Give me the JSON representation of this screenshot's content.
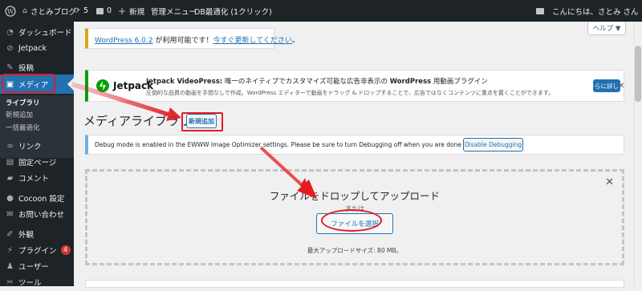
{
  "adminbar": {
    "site_name": "さとみブログ",
    "updates": "5",
    "comments": "0",
    "new_label": "新規",
    "admin_menu": "管理メニュー",
    "db_optimize": "DB最適化 (1クリック)",
    "greeting": "こんにちは、さとみ さん"
  },
  "sidebar": {
    "items": [
      {
        "label": "ダッシュボード",
        "icon": "dashboard-icon"
      },
      {
        "label": "Jetpack",
        "icon": "jetpack-icon"
      },
      {
        "label": "投稿",
        "icon": "pin-icon"
      },
      {
        "label": "メディア",
        "icon": "media-icon"
      },
      {
        "label": "リンク",
        "icon": "link-icon"
      },
      {
        "label": "固定ページ",
        "icon": "page-icon"
      },
      {
        "label": "コメント",
        "icon": "comment-icon"
      },
      {
        "label": "Cocoon 設定",
        "icon": "cocoon-icon"
      },
      {
        "label": "お問い合わせ",
        "icon": "mail-icon"
      },
      {
        "label": "外観",
        "icon": "brush-icon"
      },
      {
        "label": "プラグイン",
        "icon": "plugin-icon",
        "badge": "4"
      },
      {
        "label": "ユーザー",
        "icon": "user-icon"
      },
      {
        "label": "ツール",
        "icon": "tool-icon"
      }
    ],
    "submenu": [
      "ライブラリ",
      "新規追加",
      "一括最適化"
    ]
  },
  "main": {
    "help_label": "ヘルプ ▼",
    "update_notice": {
      "link1": "WordPress 6.0.2",
      "middle": " が利用可能です！",
      "link2": "今すぐ更新してください",
      "end": "。"
    },
    "jetpack": {
      "brand": "Jetpack",
      "title_bold": "Jetpack VideoPress:",
      "title_rest": " 唯一のネイティブでカスタマイズ可能な広告非表示の ",
      "title_bold2": "WordPress",
      "title_end": " 用動画プラグイン",
      "desc": "圧倒的な品質の動画を手間なしで作成。WordPress エディターで動画をドラッグ & ドロップすることで、広告ではなくコンテンツに重点を置くことができます。",
      "button": "さらに詳しく"
    },
    "page_title": "メディアライブラリ",
    "add_new": "新規追加",
    "debug_notice": {
      "text": "Debug mode is enabled in the EWWW Image Optimizer settings. Please be sure to turn Debugging off when you are done troubleshooting.",
      "button": "Disable Debugging"
    },
    "uploader": {
      "drop_text": "ファイルをドロップしてアップロード",
      "or_text": "または",
      "select_button": "ファイルを選択",
      "max_size": "最大アップロードサイズ: 80 MB。"
    }
  },
  "colors": {
    "accent": "#2271b1",
    "annotation": "#e31b23",
    "adminbar": "#1d2327",
    "jetpack_green": "#069e08",
    "badge": "#d63638"
  }
}
